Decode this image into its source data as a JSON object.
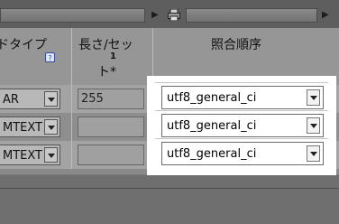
{
  "header": {
    "field_type_label": "ドタイプ",
    "length_label_line1": "長さ/セッ",
    "length_label_line2": "ト*",
    "length_footnote": "1",
    "collation_label": "照合順序",
    "help_icon": "question-icon"
  },
  "rows": [
    {
      "type_value": "AR",
      "length_value": "255",
      "collation": "utf8_general_ci"
    },
    {
      "type_value": "MTEXT",
      "length_value": "",
      "collation": "utf8_general_ci"
    },
    {
      "type_value": "MTEXT",
      "length_value": "",
      "collation": "utf8_general_ci"
    }
  ],
  "colors": {
    "highlight": "#ffffff",
    "overlay": "#7a7a7a"
  }
}
